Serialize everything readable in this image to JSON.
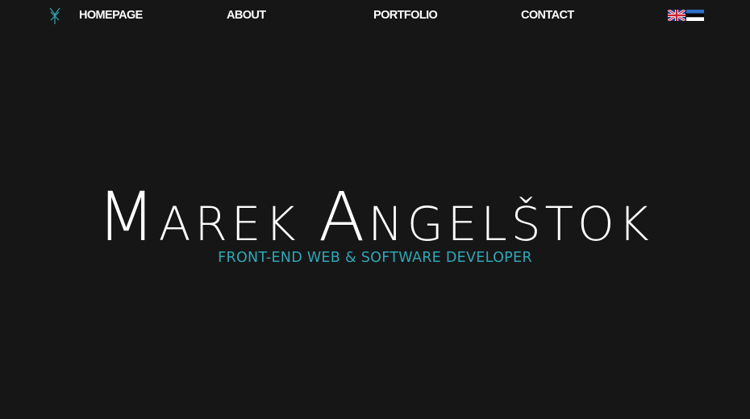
{
  "nav": {
    "logo_icon": "monogram-logo-icon",
    "items": [
      {
        "label": "HOMEPAGE"
      },
      {
        "label": "ABOUT"
      },
      {
        "label": "PORTFOLIO"
      },
      {
        "label": "CONTACT"
      }
    ],
    "languages": [
      {
        "icon": "uk-flag-icon"
      },
      {
        "icon": "estonia-flag-icon"
      }
    ]
  },
  "hero": {
    "name": "Marek Angelštok",
    "subtitle": "FRONT-END WEB & SOFTWARE DEVELOPER"
  },
  "colors": {
    "background": "#171617",
    "text": "#ffffff",
    "accent": "#2fa7b4"
  }
}
